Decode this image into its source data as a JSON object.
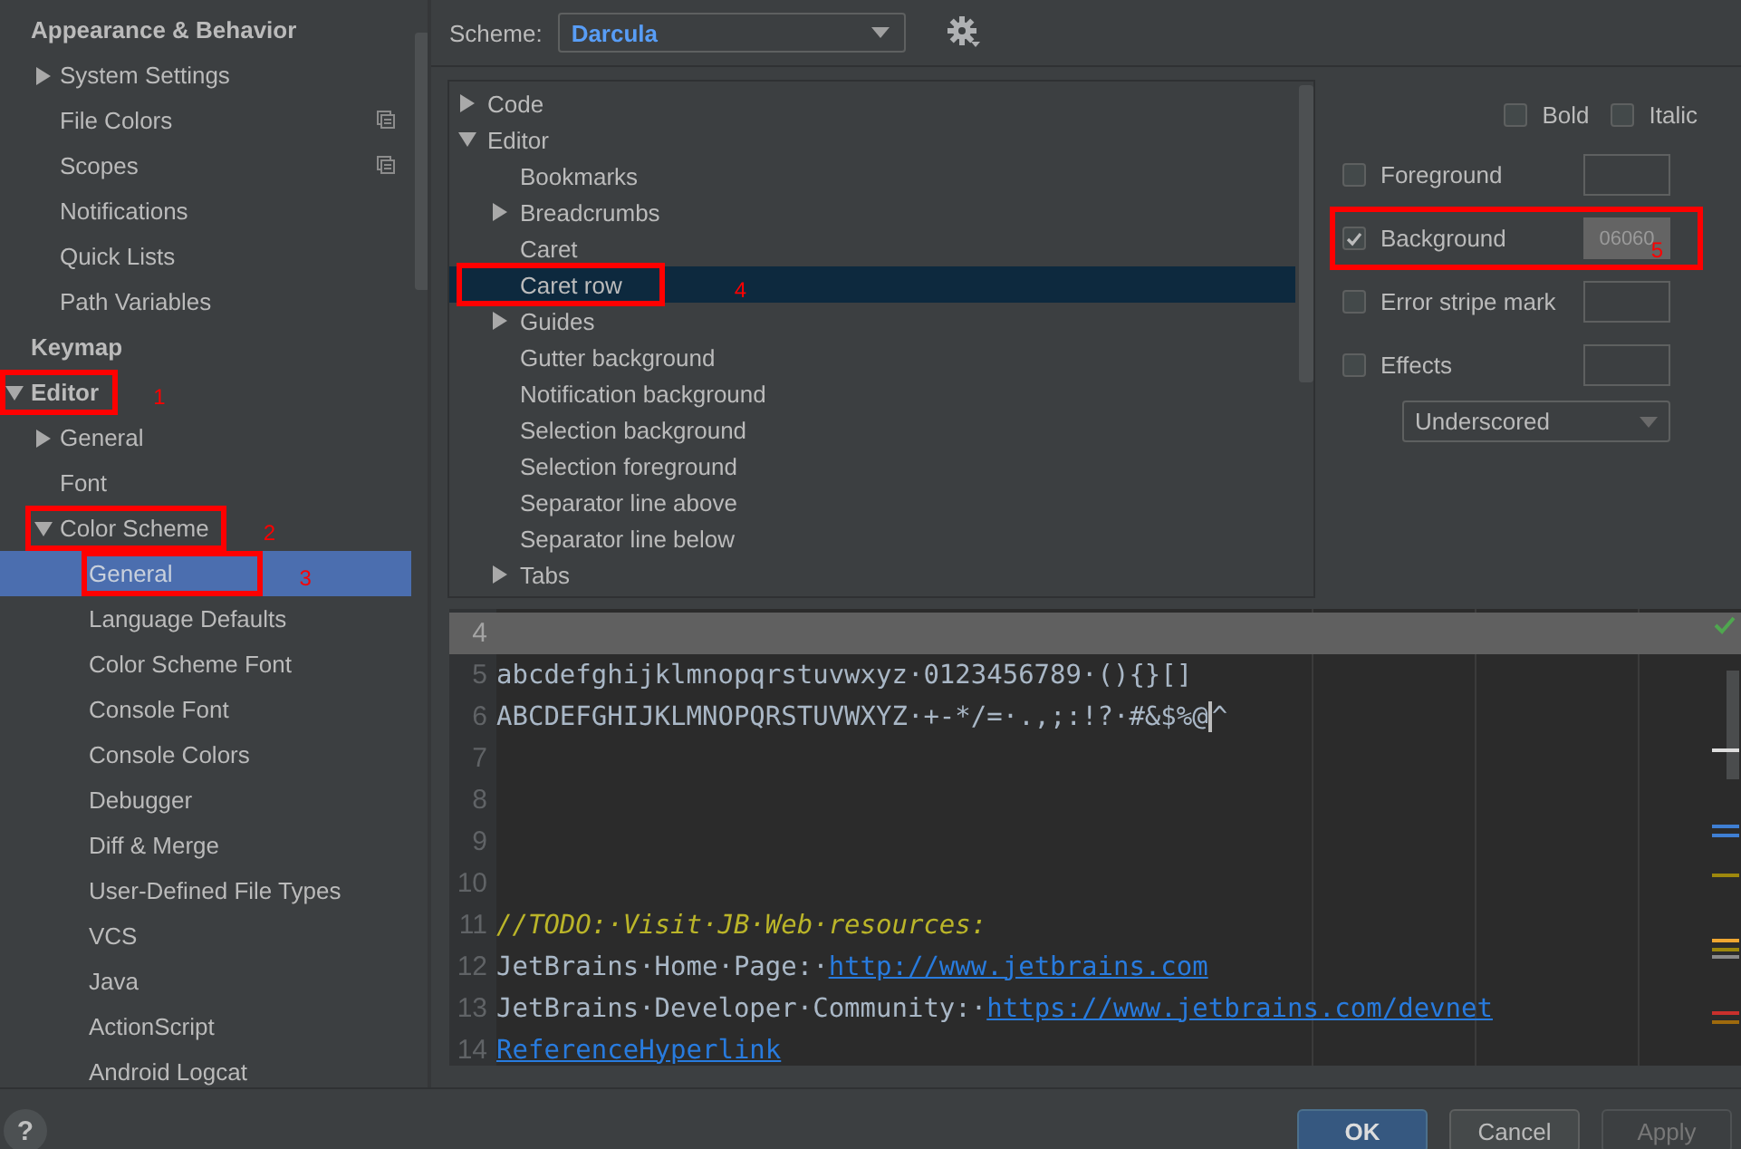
{
  "sidebar": {
    "items": [
      {
        "label": "Appearance & Behavior",
        "kind": "header",
        "selected": false,
        "children": [
          {
            "label": "System Settings",
            "kind": "folder",
            "expanded": false,
            "selected": false
          },
          {
            "label": "File Colors",
            "kind": "scoped",
            "selected": false
          },
          {
            "label": "Scopes",
            "kind": "scoped",
            "selected": false
          },
          {
            "label": "Notifications",
            "kind": "leaf",
            "selected": false
          },
          {
            "label": "Quick Lists",
            "kind": "leaf",
            "selected": false
          },
          {
            "label": "Path Variables",
            "kind": "leaf",
            "selected": false
          }
        ]
      },
      {
        "label": "Keymap",
        "kind": "header",
        "selected": false
      },
      {
        "label": "Editor",
        "kind": "header-folder",
        "expanded": true,
        "selected": false,
        "annotation": "1",
        "children": [
          {
            "label": "General",
            "kind": "folder",
            "expanded": false,
            "selected": false
          },
          {
            "label": "Font",
            "kind": "leaf",
            "selected": false
          },
          {
            "label": "Color Scheme",
            "kind": "folder",
            "expanded": true,
            "selected": false,
            "annotation": "2",
            "children": [
              {
                "label": "General",
                "kind": "leaf",
                "selected": true,
                "annotation": "3"
              },
              {
                "label": "Language Defaults",
                "kind": "leaf",
                "selected": false
              },
              {
                "label": "Color Scheme Font",
                "kind": "leaf",
                "selected": false
              },
              {
                "label": "Console Font",
                "kind": "leaf",
                "selected": false
              },
              {
                "label": "Console Colors",
                "kind": "leaf",
                "selected": false
              },
              {
                "label": "Debugger",
                "kind": "leaf",
                "selected": false
              },
              {
                "label": "Diff & Merge",
                "kind": "leaf",
                "selected": false
              },
              {
                "label": "User-Defined File Types",
                "kind": "leaf",
                "selected": false
              },
              {
                "label": "VCS",
                "kind": "leaf",
                "selected": false
              },
              {
                "label": "Java",
                "kind": "leaf",
                "selected": false
              },
              {
                "label": "ActionScript",
                "kind": "leaf",
                "selected": false
              },
              {
                "label": "Android Logcat",
                "kind": "leaf",
                "selected": false
              }
            ]
          }
        ]
      }
    ]
  },
  "scheme": {
    "label": "Scheme:",
    "value": "Darcula"
  },
  "tree": {
    "items": [
      {
        "label": "Code",
        "kind": "folder",
        "expanded": false,
        "selected": false
      },
      {
        "label": "Editor",
        "kind": "folder",
        "expanded": true,
        "selected": false,
        "children": [
          {
            "label": "Bookmarks",
            "kind": "leaf",
            "selected": false
          },
          {
            "label": "Breadcrumbs",
            "kind": "folder",
            "expanded": false,
            "selected": false
          },
          {
            "label": "Caret",
            "kind": "leaf",
            "selected": false
          },
          {
            "label": "Caret row",
            "kind": "leaf",
            "selected": true,
            "annotation": "4"
          },
          {
            "label": "Guides",
            "kind": "folder",
            "expanded": false,
            "selected": false
          },
          {
            "label": "Gutter background",
            "kind": "leaf",
            "selected": false
          },
          {
            "label": "Notification background",
            "kind": "leaf",
            "selected": false
          },
          {
            "label": "Selection background",
            "kind": "leaf",
            "selected": false
          },
          {
            "label": "Selection foreground",
            "kind": "leaf",
            "selected": false
          },
          {
            "label": "Separator line above",
            "kind": "leaf",
            "selected": false
          },
          {
            "label": "Separator line below",
            "kind": "leaf",
            "selected": false
          },
          {
            "label": "Tabs",
            "kind": "folder",
            "expanded": false,
            "selected": false
          }
        ]
      }
    ]
  },
  "properties": {
    "font_styles": [
      {
        "label": "Bold",
        "checked": false
      },
      {
        "label": "Italic",
        "checked": false
      }
    ],
    "attributes": [
      {
        "label": "Foreground",
        "checked": false
      },
      {
        "label": "Background",
        "checked": true,
        "value": "06060",
        "annotation": "5"
      },
      {
        "label": "Error stripe mark",
        "checked": false
      },
      {
        "label": "Effects",
        "checked": false
      }
    ],
    "effect_type": "Underscored"
  },
  "preview": {
    "lines": [
      {
        "number": "4",
        "current": true
      },
      {
        "number": "5",
        "current": false,
        "segments": [
          {
            "kind": "text",
            "text": "abcdefghijklmnopqrstuvwxyz·0123456789·(){}[]"
          }
        ]
      },
      {
        "number": "6",
        "current": false,
        "segments": [
          {
            "kind": "text",
            "text": "ABCDEFGHIJKLMNOPQRSTUVWXYZ·+-*/=·.,;:!?·#&$%@"
          },
          {
            "kind": "caret"
          },
          {
            "kind": "text",
            "text": "^"
          }
        ]
      },
      {
        "number": "7",
        "current": false
      },
      {
        "number": "8",
        "current": false
      },
      {
        "number": "9",
        "current": false
      },
      {
        "number": "10",
        "current": false
      },
      {
        "number": "11",
        "current": false,
        "segments": [
          {
            "kind": "todo",
            "text": "//TODO:·Visit·JB·Web·resources:"
          }
        ]
      },
      {
        "number": "12",
        "current": false,
        "segments": [
          {
            "kind": "text",
            "text": "JetBrains·Home·Page:·"
          },
          {
            "kind": "link",
            "text": "http://www.jetbrains.com"
          }
        ]
      },
      {
        "number": "13",
        "current": false,
        "segments": [
          {
            "kind": "text",
            "text": "JetBrains·Developer·Community:·"
          },
          {
            "kind": "link",
            "text": "https://www.jetbrains.com/devnet"
          }
        ]
      },
      {
        "number": "14",
        "current": false,
        "segments": [
          {
            "kind": "link",
            "text": "ReferenceHyperlink"
          }
        ]
      }
    ]
  },
  "footer": {
    "help": "?",
    "buttons": [
      {
        "label": "OK",
        "kind": "primary"
      },
      {
        "label": "Cancel",
        "kind": "normal"
      },
      {
        "label": "Apply",
        "kind": "disabled"
      }
    ]
  }
}
